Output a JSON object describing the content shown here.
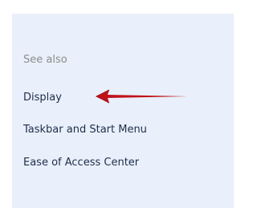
{
  "see_also": {
    "heading": "See also",
    "links": [
      {
        "label": "Display"
      },
      {
        "label": "Taskbar and Start Menu"
      },
      {
        "label": "Ease of Access Center"
      }
    ]
  },
  "annotation": {
    "arrow_icon": "left-arrow-icon",
    "color": "#c0121a"
  }
}
